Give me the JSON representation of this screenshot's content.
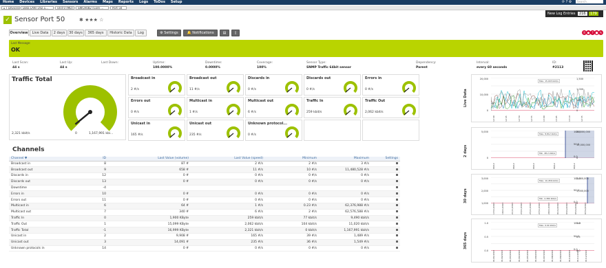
{
  "topbar": {
    "menu": [
      "Home",
      "Devices",
      "Libraries",
      "Sensors",
      "Alarms",
      "Maps",
      "Reports",
      "Logs",
      "ToDos",
      "Setup"
    ],
    "right_icons": "⟳ ? ⚙",
    "search_placeholder": "Search..."
  },
  "breadcrumbs": [
    "Devices",
    "Data LAN (192.1...",
    "Unit 0 (MD)",
    "SWCH082 (Core ...",
    "Port 50"
  ],
  "newlog": {
    "label": "New Log Entries",
    "count1": "216",
    "count2": "179"
  },
  "sensor": {
    "status_icon": "✓",
    "name": "Sensor Port 50",
    "stars": "✱ ★★★ ☆"
  },
  "tabs": [
    "Overview",
    "Live Data",
    "2 days",
    "30 days",
    "365 days",
    "Historic Data",
    "Log",
    "⚙ Settings",
    "🔔 Notifications",
    "▤",
    "▯"
  ],
  "actions": [
    "II",
    "●",
    "?",
    "■",
    "✎"
  ],
  "last_message": {
    "label": "Last Message:",
    "value": "OK"
  },
  "stats": [
    {
      "k": "Last Scan:",
      "v": "44 s"
    },
    {
      "k": "Last Up:",
      "v": "44 s"
    },
    {
      "k": "Last Down:",
      "v": ""
    },
    {
      "k": "Uptime:",
      "v": "100.0000%"
    },
    {
      "k": "Downtime:",
      "v": "0.0000%"
    },
    {
      "k": "Coverage:",
      "v": "100%"
    },
    {
      "k": "Sensor Type:",
      "v": "SNMP Traffic 64bit sensor"
    },
    {
      "k": "Dependency:",
      "v": "Parent"
    },
    {
      "k": "Interval:",
      "v": "every 60 seconds"
    },
    {
      "k": "ID:",
      "v": "#2113"
    }
  ],
  "traffic_total": {
    "title": "Traffic Total",
    "value": "2,321 kbit/s",
    "min": "0",
    "max": "1,167,991 kbi...",
    "level": 0.02
  },
  "gauges": [
    {
      "title": "Broadcast in",
      "value": "2 #/s"
    },
    {
      "title": "Broadcast out",
      "value": "11 #/s"
    },
    {
      "title": "Discards in",
      "value": "0 #/s"
    },
    {
      "title": "Discards out",
      "value": "0 #/s"
    },
    {
      "title": "Errors in",
      "value": "0 #/s"
    },
    {
      "title": "Errors out",
      "value": "0 #/s"
    },
    {
      "title": "Multicast in",
      "value": "1 #/s"
    },
    {
      "title": "Multicast out",
      "value": "6 #/s"
    },
    {
      "title": "Traffic In",
      "value": "259 kbit/s"
    },
    {
      "title": "Traffic Out",
      "value": "2,062 kbit/s"
    },
    {
      "title": "Unicast in",
      "value": "165 #/s"
    },
    {
      "title": "Unicast out",
      "value": "235 #/s"
    },
    {
      "title": "Unknown protocol...",
      "value": "0 #/s"
    }
  ],
  "channels": {
    "title": "Channels",
    "headers": [
      "Channel ▼",
      "ID",
      "Last Value (volume)",
      "Last Value (speed)",
      "Minimum",
      "Maximum",
      "Settings"
    ],
    "rows": [
      [
        "Broadcast in",
        "8",
        "87 #",
        "2 #/s",
        "2 #/s",
        "3 #/s"
      ],
      [
        "Broadcast out",
        "9",
        "658 #",
        "11 #/s",
        "10 #/s",
        "11,480,528 #/s"
      ],
      [
        "Discards in",
        "12",
        "0 #",
        "0 #/s",
        "0 #/s",
        "0 #/s"
      ],
      [
        "Discards out",
        "13",
        "0 #",
        "0 #/s",
        "0 #/s",
        "0 #/s"
      ],
      [
        "Downtime",
        "-4",
        "",
        "",
        "",
        ""
      ],
      [
        "Errors in",
        "10",
        "0 #",
        "0 #/s",
        "0 #/s",
        "0 #/s"
      ],
      [
        "Errors out",
        "11",
        "0 #",
        "0 #/s",
        "0 #/s",
        "0 #/s"
      ],
      [
        "Multicast in",
        "6",
        "64 #",
        "1 #/s",
        "0.23 #/s",
        "62,376,988 #/s"
      ],
      [
        "Multicast out",
        "7",
        "340 #",
        "6 #/s",
        "2 #/s",
        "62,576,588 #/s"
      ],
      [
        "Traffic In",
        "0",
        "1,900 KByte",
        "259 kbit/s",
        "77 kbit/s",
        "9,490 kbit/s"
      ],
      [
        "Traffic Out",
        "1",
        "15,099 KByte",
        "2,062 kbit/s",
        "104 kbit/s",
        "11,020 kbit/s"
      ],
      [
        "Traffic Total",
        "-1",
        "16,999 KByte",
        "2,321 kbit/s",
        "0 kbit/s",
        "1,167,991 kbit/s"
      ],
      [
        "Unicast in",
        "2",
        "9,908 #",
        "165 #/s",
        "39 #/s",
        "1,489 #/s"
      ],
      [
        "Unicast out",
        "3",
        "14,091 #",
        "235 #/s",
        "36 #/s",
        "1,549 #/s"
      ],
      [
        "Unknown protocols in",
        "14",
        "0 #",
        "0 #/s",
        "0 #/s",
        "0 #/s"
      ]
    ]
  },
  "graphs": [
    {
      "label": "Live Data",
      "yleft": [
        "20,000",
        "10,000",
        "0"
      ],
      "yright": [
        "1,500",
        "1,000",
        "500",
        "0"
      ],
      "tip": "Max. 15,003 kbit/s",
      "xticks": [
        "12:40",
        "12:45",
        "12:50",
        "12:55",
        "13:00",
        "13:05",
        "13:10",
        "12:35"
      ],
      "unit_l": "kbit/s",
      "unit_r": "#/s"
    },
    {
      "label": "2 days",
      "yleft": [
        "5,000",
        "0"
      ],
      "yright": [
        "20,000,000",
        "10,000,000",
        "0"
      ],
      "ymid": [
        "100.0",
        "50.0",
        "0.0"
      ],
      "tip": "Max. 8,812 kbit/s",
      "tip2": "Min. 48.2 kbit/s",
      "xticks": [
        "00/12",
        "09/12",
        "00/12",
        "09/12",
        "00/12"
      ],
      "unit_l": "kbit/s",
      "unit_r": "#/s"
    },
    {
      "label": "30 days",
      "yleft": [
        "3,000",
        "2,000",
        "1,000"
      ],
      "yright": [
        "2,000,000",
        "1,000,000",
        "0"
      ],
      "ymid": [
        "100.0",
        "50.0",
        "0.0"
      ],
      "tip": "Max. 10,456 kbit/s",
      "tip2": "Min. 2,380 kbit/s",
      "xticks": [
        "17/11/2023",
        "19/11/2023",
        "21/11/2023",
        "23/11/2023",
        "25/11/2023",
        "27/11/2023",
        "29/11/2023",
        "01/12/2023",
        "03/12/2023",
        "05/12/2023",
        "07/12/2023"
      ],
      "unit_l": "kbit/s",
      "unit_r": "#/s"
    },
    {
      "label": "365 days",
      "yleft": [
        "1.0",
        "0.5",
        "0.0"
      ],
      "yright": [
        "1.0",
        "0.5",
        "0.0"
      ],
      "ymid": [
        "100.0",
        "50.0",
        "0.0"
      ],
      "tip": "Max. 0.00 kbit/s",
      "xticks": [
        "01/01/2023",
        "01/02/2023",
        "01/03/2023",
        "01/04/2023",
        "01/05/2023",
        "01/06/2023",
        "01/07/2023",
        "01/08/2023",
        "01/09/2023",
        "01/10/2023",
        "01/11/2023",
        "01/12/2023"
      ],
      "unit_l": "kbit/s",
      "unit_r": "%"
    }
  ],
  "colors": {
    "ok": "#9dc100",
    "banner": "#b9d400",
    "topbar": "#1a3d63",
    "alert": "#d60f3b"
  }
}
